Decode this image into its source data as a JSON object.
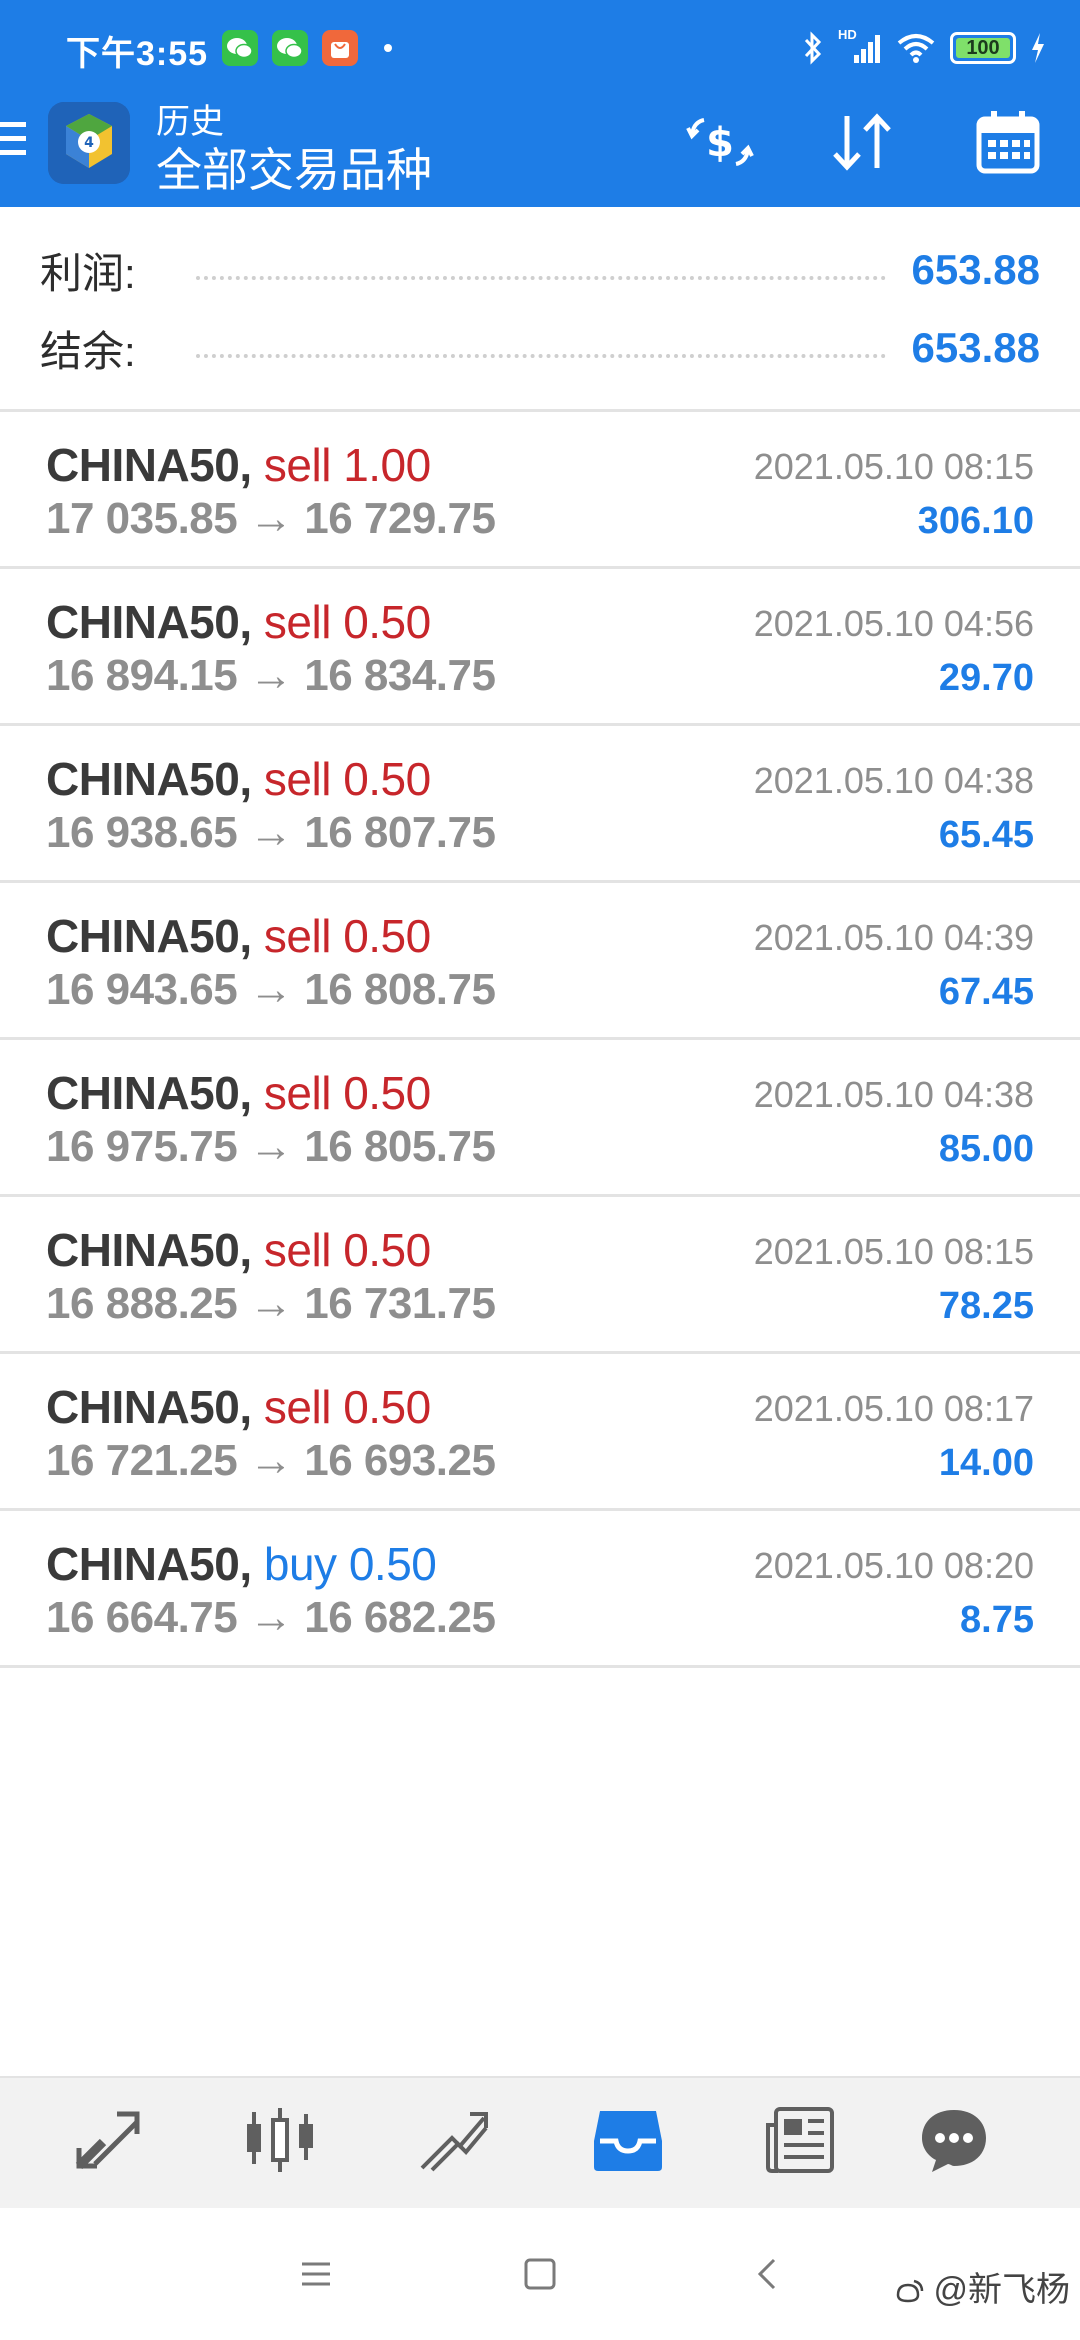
{
  "status_bar": {
    "time": "下午3:55",
    "battery": "100",
    "signal_label": "HD"
  },
  "app_bar": {
    "title": "历史",
    "subtitle": "全部交易品种"
  },
  "summary": {
    "profit_label": "利润:",
    "profit_value": "653.88",
    "balance_label": "结余:",
    "balance_value": "653.88"
  },
  "trades": [
    {
      "symbol": "CHINA50,",
      "side": "sell 1.00",
      "direction": "sell",
      "open": "17 035.85",
      "close": "16 729.75",
      "time": "2021.05.10 08:15",
      "profit": "306.10"
    },
    {
      "symbol": "CHINA50,",
      "side": "sell 0.50",
      "direction": "sell",
      "open": "16 894.15",
      "close": "16 834.75",
      "time": "2021.05.10 04:56",
      "profit": "29.70"
    },
    {
      "symbol": "CHINA50,",
      "side": "sell 0.50",
      "direction": "sell",
      "open": "16 938.65",
      "close": "16 807.75",
      "time": "2021.05.10 04:38",
      "profit": "65.45"
    },
    {
      "symbol": "CHINA50,",
      "side": "sell 0.50",
      "direction": "sell",
      "open": "16 943.65",
      "close": "16 808.75",
      "time": "2021.05.10 04:39",
      "profit": "67.45"
    },
    {
      "symbol": "CHINA50,",
      "side": "sell 0.50",
      "direction": "sell",
      "open": "16 975.75",
      "close": "16 805.75",
      "time": "2021.05.10 04:38",
      "profit": "85.00"
    },
    {
      "symbol": "CHINA50,",
      "side": "sell 0.50",
      "direction": "sell",
      "open": "16 888.25",
      "close": "16 731.75",
      "time": "2021.05.10 08:15",
      "profit": "78.25"
    },
    {
      "symbol": "CHINA50,",
      "side": "sell 0.50",
      "direction": "sell",
      "open": "16 721.25",
      "close": "16 693.25",
      "time": "2021.05.10 08:17",
      "profit": "14.00"
    },
    {
      "symbol": "CHINA50,",
      "side": "buy 0.50",
      "direction": "buy",
      "open": "16 664.75",
      "close": "16 682.25",
      "time": "2021.05.10 08:20",
      "profit": "8.75"
    }
  ],
  "arrow": "→",
  "tabs": [
    {
      "name": "quotes",
      "icon": "quotes-icon"
    },
    {
      "name": "chart",
      "icon": "candlestick-icon"
    },
    {
      "name": "trade",
      "icon": "trend-icon"
    },
    {
      "name": "history",
      "icon": "inbox-icon",
      "active": true
    },
    {
      "name": "news",
      "icon": "news-icon"
    },
    {
      "name": "chat",
      "icon": "chat-icon"
    }
  ],
  "watermark": "@新飞杨",
  "colors": {
    "accent": "#1e7de6",
    "sell": "#c7262b",
    "buy": "#1e7de6",
    "muted": "#8e8e8e"
  }
}
